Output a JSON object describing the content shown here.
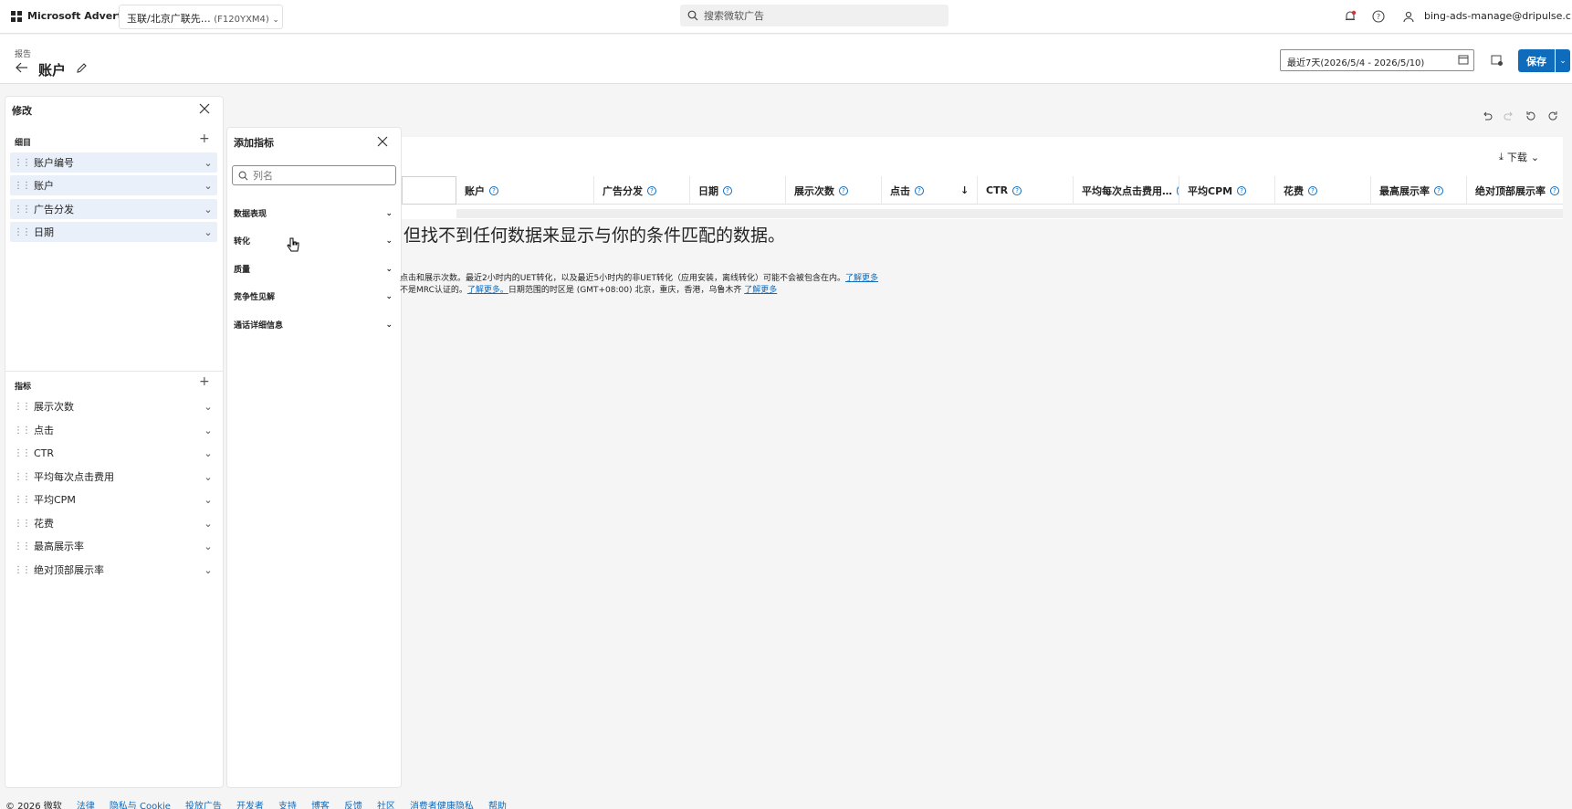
{
  "topbar": {
    "brand": "Microsoft Advertising",
    "account_name": "玉联/北京广联先…",
    "account_id": "(F120YXM4)",
    "search_placeholder": "搜索微软广告",
    "user_email": "bing-ads-manage@dripulse.c..."
  },
  "header": {
    "breadcrumb": "报告",
    "title": "账户",
    "date_range": "最近7天(2026/5/4 - 2026/5/10)",
    "save_label": "保存"
  },
  "modify_panel": {
    "title": "修改",
    "details_label": "细目",
    "details": [
      {
        "label": "账户编号"
      },
      {
        "label": "账户"
      },
      {
        "label": "广告分发"
      },
      {
        "label": "日期"
      }
    ],
    "metrics_label": "指标",
    "metrics": [
      {
        "label": "展示次数"
      },
      {
        "label": "点击"
      },
      {
        "label": "CTR"
      },
      {
        "label": "平均每次点击费用"
      },
      {
        "label": "平均CPM"
      },
      {
        "label": "花费"
      },
      {
        "label": "最高展示率"
      },
      {
        "label": "绝对顶部展示率"
      }
    ]
  },
  "add_metric_panel": {
    "title": "添加指标",
    "search_placeholder": "列名",
    "categories": [
      {
        "label": "数据表现"
      },
      {
        "label": "转化"
      },
      {
        "label": "质量"
      },
      {
        "label": "竞争性见解"
      },
      {
        "label": "通话详细信息"
      }
    ]
  },
  "grid": {
    "download_label": "下载",
    "columns": [
      {
        "label": "账户"
      },
      {
        "label": "广告分发"
      },
      {
        "label": "日期"
      },
      {
        "label": "展示次数"
      },
      {
        "label": "点击"
      },
      {
        "label": "CTR"
      },
      {
        "label": "平均每次点击费用…"
      },
      {
        "label": "平均CPM"
      },
      {
        "label": "花费"
      },
      {
        "label": "最高展示率"
      },
      {
        "label": "绝对顶部展示率"
      }
    ],
    "no_data_message": "但找不到任何数据来显示与你的条件匹配的数据。",
    "note_line1": "点击和展示次数。最近2小时内的UET转化，以及最近5小时内的非UET转化（应用安装，离线转化）可能不会被包含在内。",
    "note_line1_link": "了解更多",
    "note_line2_a": "不是MRC认证的。",
    "note_line2_link": "了解更多。",
    "note_line2_b": "日期范围的时区是 (GMT+08:00) 北京，重庆，香港，乌鲁木齐",
    "note_line2_link2": "了解更多"
  },
  "footer": {
    "copyright": "© 2026 微软",
    "links": [
      {
        "label": "法律"
      },
      {
        "label": "隐私与 Cookie"
      },
      {
        "label": "投放广告"
      },
      {
        "label": "开发者"
      },
      {
        "label": "支持"
      },
      {
        "label": "博客"
      },
      {
        "label": "反馈"
      },
      {
        "label": "社区"
      },
      {
        "label": "消费者健康隐私"
      },
      {
        "label": "帮助"
      }
    ]
  },
  "colors": {
    "accent": "#0f6cbd",
    "highlight": "#e9f0fa",
    "notification": "#d13438"
  }
}
